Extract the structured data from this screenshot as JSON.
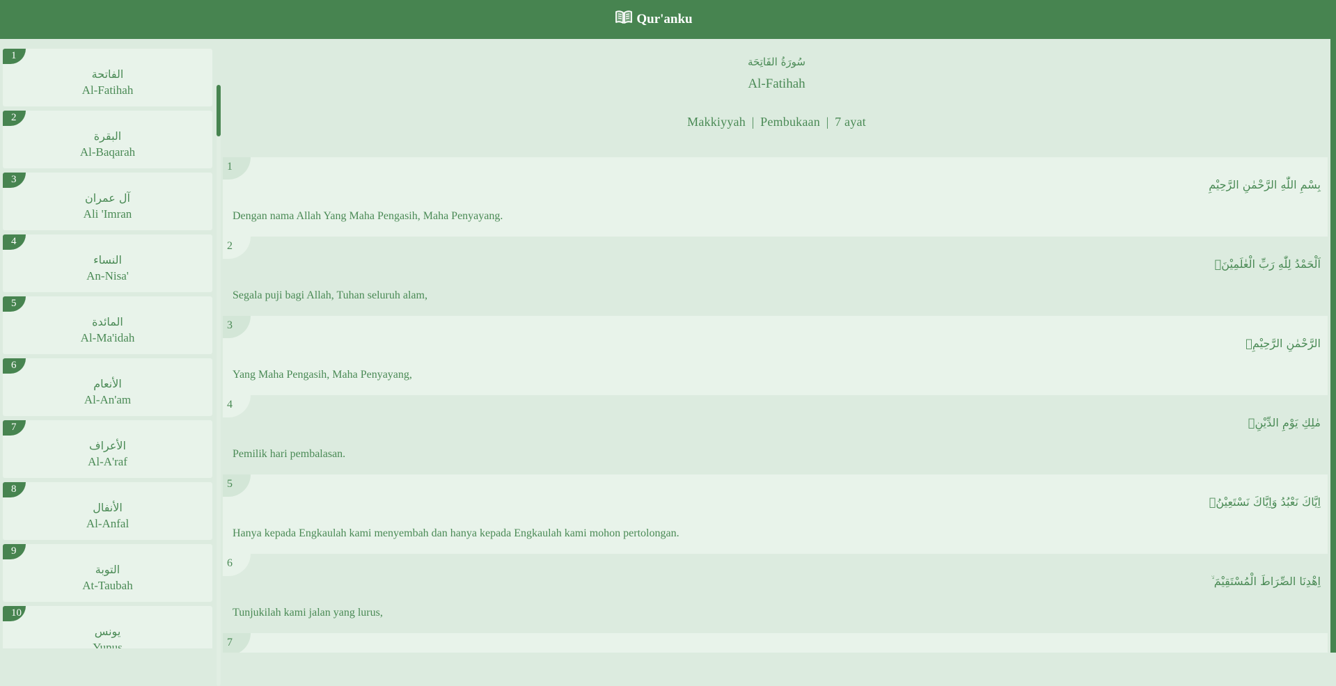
{
  "app": {
    "title": "Qur'anku",
    "accent": "#478450"
  },
  "sidebar": {
    "items": [
      {
        "number": "1",
        "arabic": "الفاتحة",
        "latin": "Al-Fatihah"
      },
      {
        "number": "2",
        "arabic": "البقرة",
        "latin": "Al-Baqarah"
      },
      {
        "number": "3",
        "arabic": "آل عمران",
        "latin": "Ali 'Imran"
      },
      {
        "number": "4",
        "arabic": "النساء",
        "latin": "An-Nisa'"
      },
      {
        "number": "5",
        "arabic": "المائدة",
        "latin": "Al-Ma'idah"
      },
      {
        "number": "6",
        "arabic": "الأنعام",
        "latin": "Al-An'am"
      },
      {
        "number": "7",
        "arabic": "الأعراف",
        "latin": "Al-A'raf"
      },
      {
        "number": "8",
        "arabic": "الأنفال",
        "latin": "Al-Anfal"
      },
      {
        "number": "9",
        "arabic": "التوبة",
        "latin": "At-Taubah"
      },
      {
        "number": "10",
        "arabic": "يونس",
        "latin": "Yunus"
      }
    ]
  },
  "surah": {
    "arabic_title": "سُورَةُ الفَاتِحَة",
    "latin_title": "Al-Fatihah",
    "revelation": "Makkiyyah",
    "meaning": "Pembukaan",
    "ayah_count": "7 ayat",
    "separator": "|"
  },
  "ayahs": [
    {
      "number": "1",
      "arabic": "بِسْمِ اللّٰهِ الرَّحْمٰنِ الرَّحِيْمِ",
      "translation": "Dengan nama Allah Yang Maha Pengasih, Maha Penyayang."
    },
    {
      "number": "2",
      "arabic": "اَلْحَمْدُ لِلّٰهِ رَبِّ الْعٰلَمِيْنَۙ",
      "translation": "Segala puji bagi Allah, Tuhan seluruh alam,"
    },
    {
      "number": "3",
      "arabic": "الرَّحْمٰنِ الرَّحِيْمِۙ",
      "translation": "Yang Maha Pengasih, Maha Penyayang,"
    },
    {
      "number": "4",
      "arabic": "مٰلِكِ يَوْمِ الدِّيْنِۗ",
      "translation": "Pemilik hari pembalasan."
    },
    {
      "number": "5",
      "arabic": "اِيَّاكَ نَعْبُدُ وَاِيَّاكَ نَسْتَعِيْنُۗ",
      "translation": "Hanya kepada Engkaulah kami menyembah dan hanya kepada Engkaulah kami mohon pertolongan."
    },
    {
      "number": "6",
      "arabic": "اِهْدِنَا الصِّرَاطَ الْمُسْتَقِيْمَ ۙ",
      "translation": "Tunjukilah kami jalan yang lurus,"
    },
    {
      "number": "7",
      "arabic": "",
      "translation": ""
    }
  ]
}
